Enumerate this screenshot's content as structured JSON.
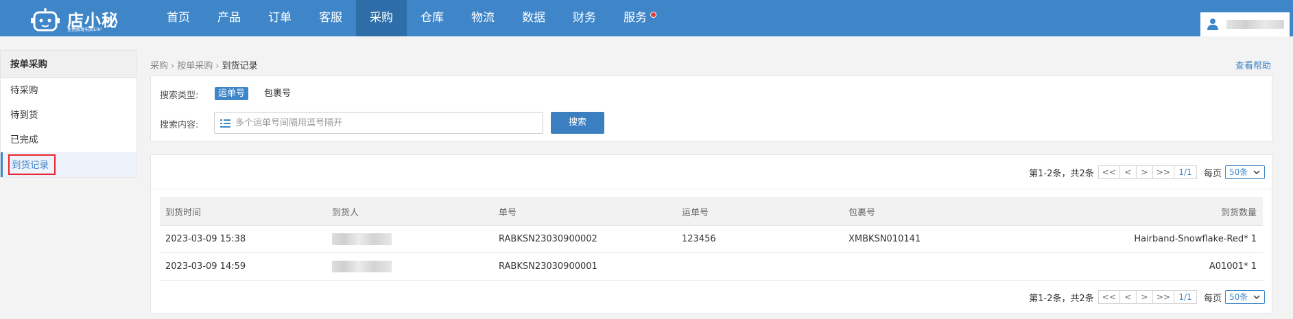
{
  "header": {
    "brand": "店小秘",
    "brand_sub": "免费跨境电商ERP",
    "nav": [
      {
        "label": "首页",
        "active": false
      },
      {
        "label": "产品",
        "active": false
      },
      {
        "label": "订单",
        "active": false
      },
      {
        "label": "客服",
        "active": false
      },
      {
        "label": "采购",
        "active": true
      },
      {
        "label": "仓库",
        "active": false
      },
      {
        "label": "物流",
        "active": false
      },
      {
        "label": "数据",
        "active": false
      },
      {
        "label": "财务",
        "active": false
      },
      {
        "label": "服务",
        "active": false
      }
    ],
    "accent_color": "#3f86c9",
    "notification_color": "#e53935"
  },
  "sidebar": {
    "title": "按单采购",
    "items": [
      {
        "label": "待采购"
      },
      {
        "label": "待到货"
      },
      {
        "label": "已完成"
      },
      {
        "label": "到货记录",
        "active": true
      }
    ]
  },
  "breadcrumb": {
    "items": [
      "采购",
      "按单采购",
      "到货记录"
    ],
    "help": "查看帮助"
  },
  "search": {
    "type_label": "搜索类型:",
    "types": [
      {
        "label": "运单号",
        "selected": true
      },
      {
        "label": "包裹号",
        "selected": false
      }
    ],
    "content_label": "搜索内容:",
    "placeholder": "多个运单号间隔用逗号隔开",
    "value": "",
    "button": "搜索"
  },
  "pager": {
    "info": "第1-2条，共2条",
    "first": "<<",
    "prev": "<",
    "next": ">",
    "last": ">>",
    "page": "1/1",
    "per_label": "每页",
    "per_value": "50条"
  },
  "table": {
    "columns": [
      "到货时间",
      "到货人",
      "单号",
      "运单号",
      "包裹号",
      "到货数量"
    ],
    "rows": [
      {
        "time": "2023-03-09 15:38",
        "receiver": "",
        "order": "RABKSN23030900002",
        "tracking": "123456",
        "package": "XMBKSN010141",
        "qty": "Hairband-Snowflake-Red* 1"
      },
      {
        "time": "2023-03-09 14:59",
        "receiver": "",
        "order": "RABKSN23030900001",
        "tracking": "",
        "package": "",
        "qty": "A01001* 1"
      }
    ]
  }
}
